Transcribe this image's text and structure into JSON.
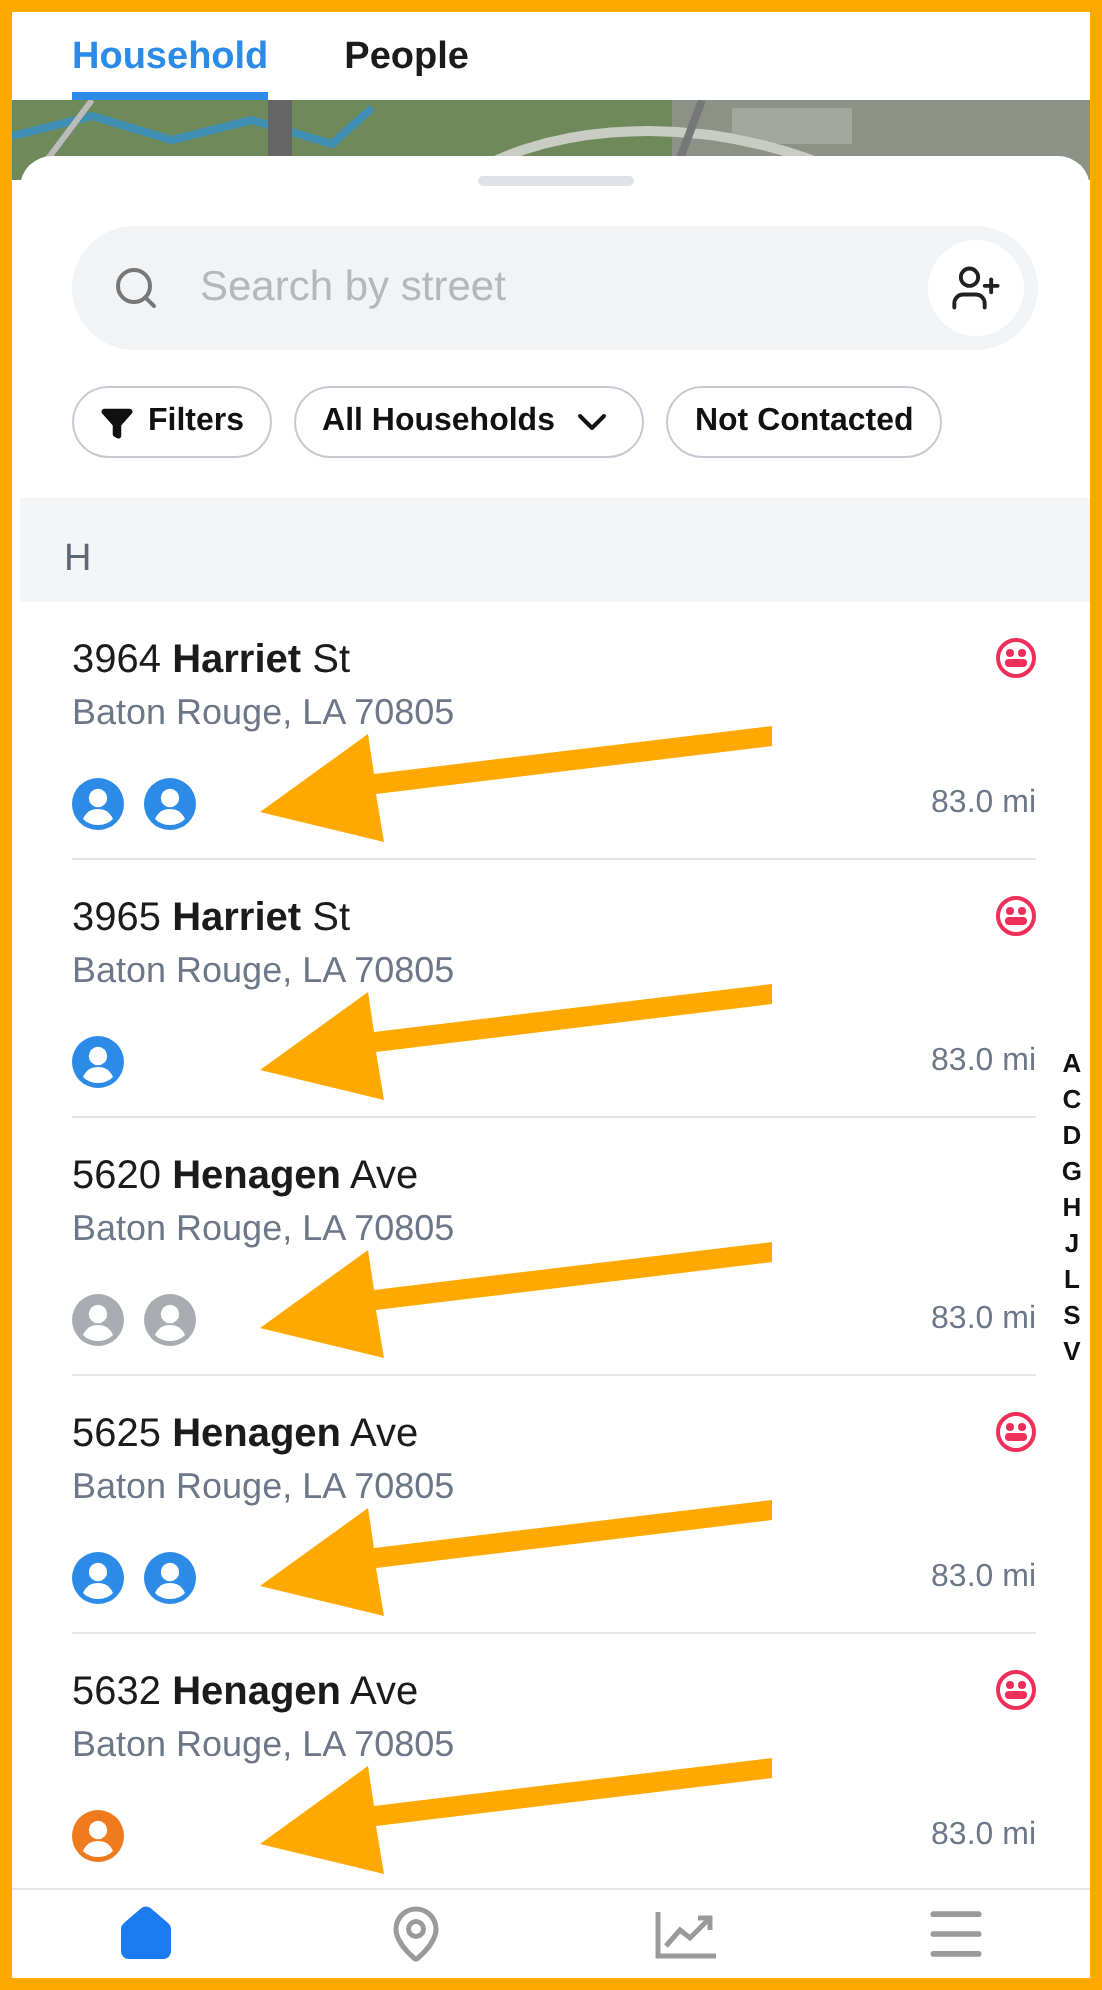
{
  "tabs": [
    {
      "label": "Household",
      "selected": true
    },
    {
      "label": "People",
      "selected": false
    }
  ],
  "search": {
    "placeholder": "Search by street"
  },
  "chips": [
    {
      "label": "Filters",
      "kind": "filter"
    },
    {
      "label": "All Households",
      "kind": "dropdown"
    },
    {
      "label": "Not Contacted",
      "kind": "plain"
    }
  ],
  "section": "H",
  "rows": [
    {
      "street": "3964 **Harriet** St",
      "city": "Baton Rouge, LA 70805",
      "people": [
        {
          "color": "#2b8be6"
        },
        {
          "color": "#2b8be6"
        }
      ],
      "flagged": true,
      "distance": "83.0 mi",
      "arrow": true
    },
    {
      "street": "3965 **Harriet** St",
      "city": "Baton Rouge, LA 70805",
      "people": [
        {
          "color": "#2b8be6"
        }
      ],
      "flagged": true,
      "distance": "83.0 mi",
      "arrow": true
    },
    {
      "street": "5620 **Henagen** Ave",
      "city": "Baton Rouge, LA 70805",
      "people": [
        {
          "color": "#a9adb2"
        },
        {
          "color": "#a9adb2"
        }
      ],
      "flagged": false,
      "distance": "83.0 mi",
      "arrow": true
    },
    {
      "street": "5625 **Henagen** Ave",
      "city": "Baton Rouge, LA 70805",
      "people": [
        {
          "color": "#2b8be6"
        },
        {
          "color": "#2b8be6"
        }
      ],
      "flagged": true,
      "distance": "83.0 mi",
      "arrow": true
    },
    {
      "street": "5632 **Henagen** Ave",
      "city": "Baton Rouge, LA 70805",
      "people": [
        {
          "color": "#f07a1e"
        }
      ],
      "flagged": true,
      "distance": "83.0 mi",
      "arrow": true
    }
  ],
  "index_letters": [
    "A",
    "C",
    "D",
    "G",
    "H",
    "J",
    "L",
    "S",
    "V"
  ],
  "nav": [
    {
      "kind": "home",
      "selected": true
    },
    {
      "kind": "map",
      "selected": false
    },
    {
      "kind": "chart",
      "selected": false
    },
    {
      "kind": "menu",
      "selected": false
    }
  ]
}
